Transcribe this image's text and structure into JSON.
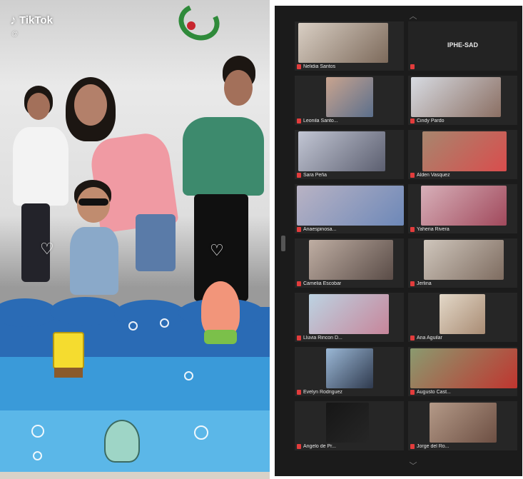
{
  "tiktok": {
    "logo_text": "TikTok",
    "handle": "@",
    "left_heart_icon": "heart-icon",
    "right_heart_icon": "heart-icon"
  },
  "zoom": {
    "tiles": [
      {
        "name": "Nelidia Santos",
        "label": "",
        "video": true
      },
      {
        "name": "",
        "label": "IPHE-SAD",
        "video": false
      },
      {
        "name": "Leonila Santo...",
        "label": "",
        "video": true
      },
      {
        "name": "Cindy Pardo",
        "label": "",
        "video": true
      },
      {
        "name": "Sara Peña",
        "label": "",
        "video": true
      },
      {
        "name": "Alden Vasquez",
        "label": "",
        "video": true
      },
      {
        "name": "Anaespinosa...",
        "label": "",
        "video": true
      },
      {
        "name": "Yaheria Rivera",
        "label": "",
        "video": true
      },
      {
        "name": "Camelia Escobar",
        "label": "",
        "video": true
      },
      {
        "name": "Jerlina",
        "label": "",
        "video": true
      },
      {
        "name": "Lluvia Rincon D...",
        "label": "",
        "video": true
      },
      {
        "name": "Ana Aguilar",
        "label": "",
        "video": true
      },
      {
        "name": "Evelyn Rodriguez",
        "label": "",
        "video": true
      },
      {
        "name": "Augusto Cast...",
        "label": "",
        "video": true
      },
      {
        "name": "Angelo de Pr...",
        "label": "",
        "video": true
      },
      {
        "name": "Jorge del Ro...",
        "label": "",
        "video": true
      }
    ]
  }
}
